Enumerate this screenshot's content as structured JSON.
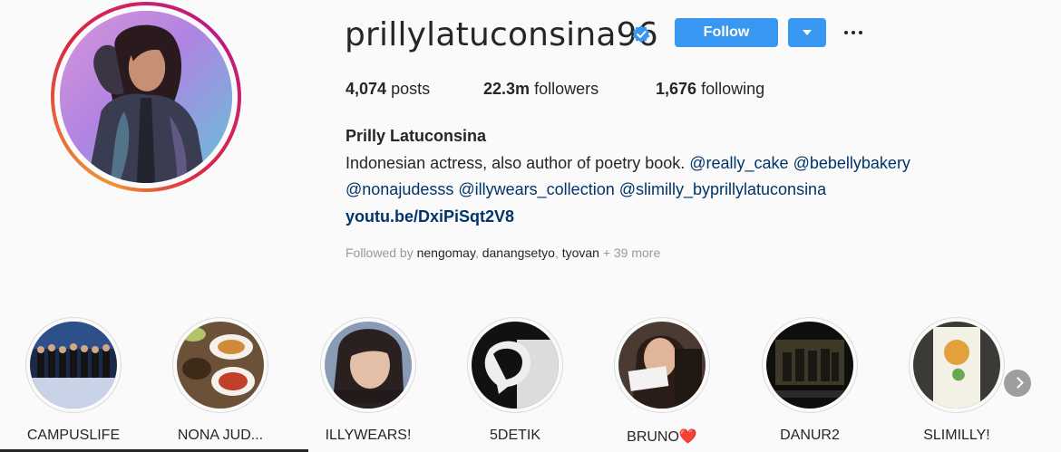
{
  "profile": {
    "username": "prillylatuconsina96",
    "verified_icon": "verified-badge-icon",
    "follow_label": "Follow",
    "dropdown_icon": "chevron-down-icon",
    "more_icon": "ellipsis-icon",
    "stats": {
      "posts_count": "4,074",
      "posts_label": "posts",
      "followers_count": "22.3m",
      "followers_label": "followers",
      "following_count": "1,676",
      "following_label": "following"
    },
    "full_name": "Prilly Latuconsina",
    "bio": {
      "text": "Indonesian actress, also author of poetry book.",
      "mention1": "@really_cake",
      "mention2": "@bebellybakery",
      "mention3": "@nonajudesss",
      "mention4": "@illywears_collection",
      "mention5": "@slimilly_byprillylatuconsina"
    },
    "website": "youtu.be/DxiPiSqt2V8",
    "followed_by": {
      "prefix": "Followed by",
      "user1": "nengomay",
      "user2": "danangsetyo",
      "user3": "tyovan",
      "more": "+ 39 more"
    }
  },
  "highlights": [
    {
      "label": "CAMPUSLIFE"
    },
    {
      "label": "NONA JUD..."
    },
    {
      "label": "ILLYWEARS!"
    },
    {
      "label": "5DETIK"
    },
    {
      "label": "BRUNO",
      "emoji": "❤️"
    },
    {
      "label": "DANUR2"
    },
    {
      "label": "SLIMILLY!"
    }
  ],
  "colors": {
    "primary_button": "#3897f0",
    "link": "#003569",
    "verified": "#3897f0"
  }
}
